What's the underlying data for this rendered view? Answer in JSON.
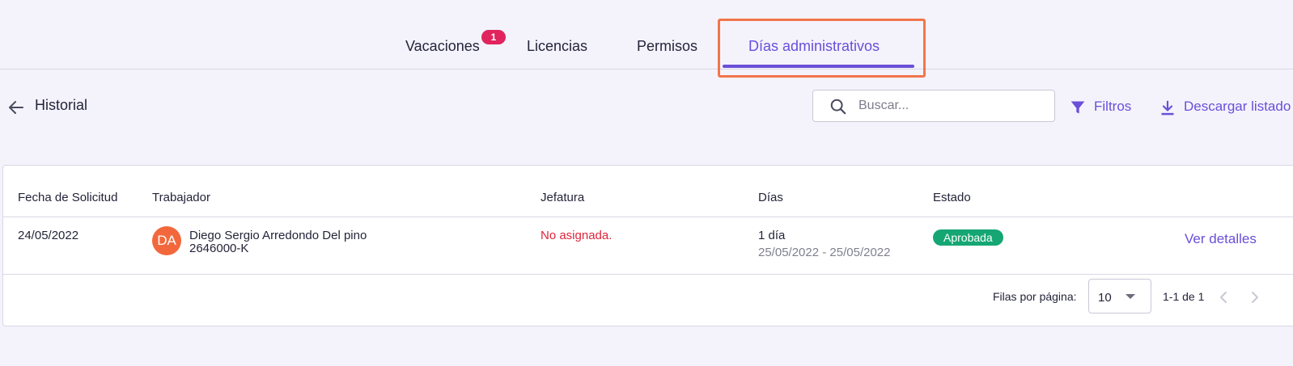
{
  "tabs": [
    {
      "label": "Vacaciones",
      "badge": "1"
    },
    {
      "label": "Licencias"
    },
    {
      "label": "Permisos"
    },
    {
      "label": "Días administrativos",
      "active": true
    }
  ],
  "toolbar": {
    "title": "Historial",
    "search_placeholder": "Buscar...",
    "filters_label": "Filtros",
    "download_label": "Descargar listado"
  },
  "table": {
    "columns": [
      "Fecha de Solicitud",
      "Trabajador",
      "Jefatura",
      "Días",
      "Estado"
    ],
    "rows": [
      {
        "date": "24/05/2022",
        "avatar_initials": "DA",
        "worker_name": "Diego Sergio Arredondo Del pino",
        "worker_id": "2646000-K",
        "boss": "No asignada.",
        "days": "1 día",
        "range": "25/05/2022 - 25/05/2022",
        "status": "Aprobada",
        "action": "Ver detalles"
      }
    ]
  },
  "pagination": {
    "rows_per_page_label": "Filas por página:",
    "rows_per_page": "10",
    "range_text": "1-1 de 1"
  },
  "colors": {
    "accent": "#6a4fd8",
    "badge": "#e0245e",
    "highlight": "#f2754a",
    "status_approved": "#15a674",
    "avatar": "#f2683c",
    "unassigned": "#e0243a"
  }
}
